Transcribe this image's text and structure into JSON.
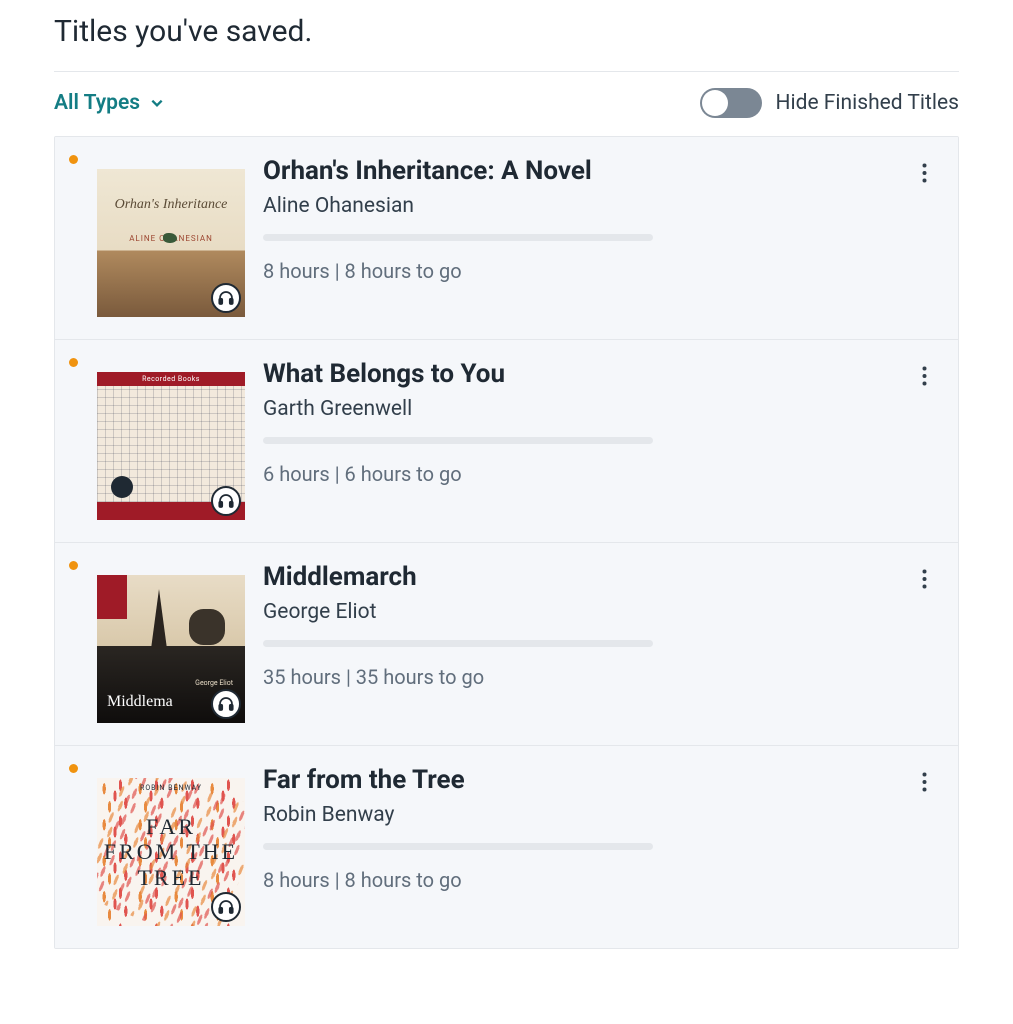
{
  "header": {
    "title": "Titles you've saved."
  },
  "controls": {
    "filter_label": "All Types",
    "toggle_label": "Hide Finished Titles",
    "toggle_on": false
  },
  "items": [
    {
      "title": "Orhan's Inheritance: A Novel",
      "author": "Aline Ohanesian",
      "duration": "8 hours | 8 hours to go",
      "progress_pct": 0,
      "format": "audiobook",
      "cover": {
        "style": "orhan",
        "cover_title": "Orhan's Inheritance",
        "cover_author": "ALINE OHANESIAN"
      }
    },
    {
      "title": "What Belongs to You",
      "author": "Garth Greenwell",
      "duration": "6 hours | 6 hours to go",
      "progress_pct": 0,
      "format": "audiobook",
      "cover": {
        "style": "belongs",
        "publisher": "Recorded Books"
      }
    },
    {
      "title": "Middlemarch",
      "author": "George Eliot",
      "duration": "35 hours | 35 hours to go",
      "progress_pct": 0,
      "format": "audiobook",
      "cover": {
        "style": "middle",
        "cover_title": "Middlema",
        "cover_author": "George Eliot"
      }
    },
    {
      "title": "Far from the Tree",
      "author": "Robin Benway",
      "duration": "8 hours | 8 hours to go",
      "progress_pct": 0,
      "format": "audiobook",
      "cover": {
        "style": "far",
        "line1": "FAR",
        "line2": "FROM THE",
        "line3": "TREE",
        "cover_author": "ROBIN BENWAY"
      }
    }
  ]
}
